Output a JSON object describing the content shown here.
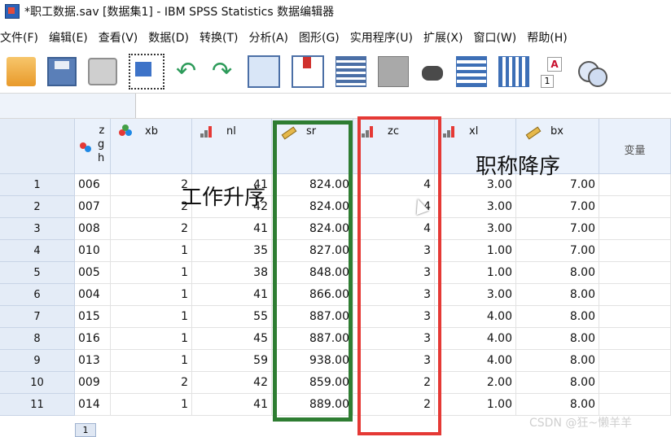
{
  "title_bar": {
    "title": "*职工数据.sav [数据集1] - IBM SPSS Statistics 数据编辑器"
  },
  "menu": [
    "文件(F)",
    "编辑(E)",
    "查看(V)",
    "数据(D)",
    "转换(T)",
    "分析(A)",
    "图形(G)",
    "实用程序(U)",
    "扩展(X)",
    "窗口(W)",
    "帮助(H)"
  ],
  "toolbar_icons": [
    "open-folder-icon",
    "save-icon",
    "print-icon",
    "recall-dialog-icon",
    "undo-icon",
    "redo-icon",
    "goto-case-icon",
    "goto-variable-icon",
    "variables-icon",
    "chart-icon",
    "find-icon",
    "insert-cases-icon",
    "insert-variable-icon",
    "value-labels-icon",
    "use-sets-icon"
  ],
  "value_labels_icon": {
    "a": "A",
    "one": "1"
  },
  "columns": [
    {
      "name": "z\ng\nh",
      "type": "string"
    },
    {
      "name": "xb",
      "type": "nominal"
    },
    {
      "name": "nl",
      "type": "ordinal"
    },
    {
      "name": "sr",
      "type": "scale"
    },
    {
      "name": "zc",
      "type": "ordinal"
    },
    {
      "name": "xl",
      "type": "ordinal"
    },
    {
      "name": "bx",
      "type": "scale"
    },
    {
      "name": "变量",
      "type": "placeholder"
    }
  ],
  "rows": [
    {
      "n": "1",
      "zgh": "006",
      "xb": "2",
      "nl": "41",
      "sr": "824.00",
      "zc": "4",
      "xl": "3.00",
      "bx": "7.00"
    },
    {
      "n": "2",
      "zgh": "007",
      "xb": "2",
      "nl": "42",
      "sr": "824.00",
      "zc": "4",
      "xl": "3.00",
      "bx": "7.00"
    },
    {
      "n": "3",
      "zgh": "008",
      "xb": "2",
      "nl": "41",
      "sr": "824.00",
      "zc": "4",
      "xl": "3.00",
      "bx": "7.00"
    },
    {
      "n": "4",
      "zgh": "010",
      "xb": "1",
      "nl": "35",
      "sr": "827.00",
      "zc": "3",
      "xl": "1.00",
      "bx": "7.00"
    },
    {
      "n": "5",
      "zgh": "005",
      "xb": "1",
      "nl": "38",
      "sr": "848.00",
      "zc": "3",
      "xl": "1.00",
      "bx": "8.00"
    },
    {
      "n": "6",
      "zgh": "004",
      "xb": "1",
      "nl": "41",
      "sr": "866.00",
      "zc": "3",
      "xl": "3.00",
      "bx": "8.00"
    },
    {
      "n": "7",
      "zgh": "015",
      "xb": "1",
      "nl": "55",
      "sr": "887.00",
      "zc": "3",
      "xl": "4.00",
      "bx": "8.00"
    },
    {
      "n": "8",
      "zgh": "016",
      "xb": "1",
      "nl": "45",
      "sr": "887.00",
      "zc": "3",
      "xl": "4.00",
      "bx": "8.00"
    },
    {
      "n": "9",
      "zgh": "013",
      "xb": "1",
      "nl": "59",
      "sr": "938.00",
      "zc": "3",
      "xl": "4.00",
      "bx": "8.00"
    },
    {
      "n": "10",
      "zgh": "009",
      "xb": "2",
      "nl": "42",
      "sr": "859.00",
      "zc": "2",
      "xl": "2.00",
      "bx": "8.00"
    },
    {
      "n": "11",
      "zgh": "014",
      "xb": "1",
      "nl": "41",
      "sr": "889.00",
      "zc": "2",
      "xl": "1.00",
      "bx": "8.00"
    }
  ],
  "annotations": {
    "left": "工作升序",
    "right": "职称降序"
  },
  "watermark": "CSDN @狂~懒羊羊",
  "bottom_tab": "1",
  "colors": {
    "green_box": "#2e7d32",
    "red_box": "#e53935",
    "header_bg": "#eaf1fb"
  }
}
